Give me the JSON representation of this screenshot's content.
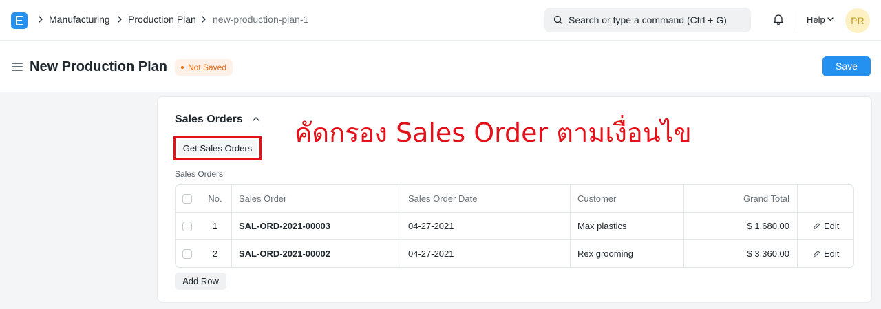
{
  "navbar": {
    "breadcrumbs": [
      "Manufacturing",
      "Production Plan",
      "new-production-plan-1"
    ],
    "search_placeholder": "Search or type a command (Ctrl + G)",
    "help_label": "Help",
    "avatar_initials": "PR"
  },
  "page": {
    "title": "New Production Plan",
    "status": "Not Saved",
    "save_label": "Save"
  },
  "section": {
    "title": "Sales Orders",
    "get_button": "Get Sales Orders",
    "annotation": "คัดกรอง Sales Order ตามเงื่อนไข",
    "table_label": "Sales Orders",
    "columns": [
      "No.",
      "Sales Order",
      "Sales Order Date",
      "Customer",
      "Grand Total"
    ],
    "rows": [
      {
        "no": "1",
        "sales_order": "SAL-ORD-2021-00003",
        "date": "04-27-2021",
        "customer": "Max plastics",
        "total": "$ 1,680.00",
        "edit": "Edit"
      },
      {
        "no": "2",
        "sales_order": "SAL-ORD-2021-00002",
        "date": "04-27-2021",
        "customer": "Rex grooming",
        "total": "$ 3,360.00",
        "edit": "Edit"
      }
    ],
    "add_row": "Add Row"
  },
  "colors": {
    "accent": "#2490ef",
    "annotation_red": "#e3121a",
    "not_saved_orange": "#e86c13"
  }
}
